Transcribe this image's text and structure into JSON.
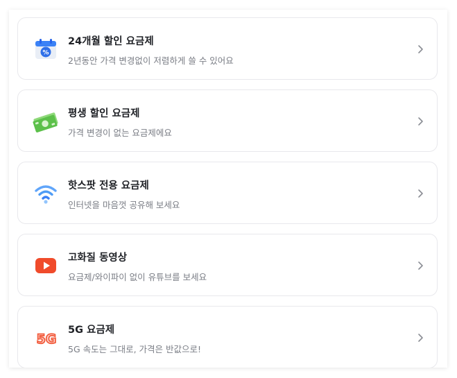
{
  "plans": [
    {
      "title": "24개월 할인 요금제",
      "description": "2년동안 가격 변경없이 저렴하게 쓸 수 있어요",
      "icon": "calendar-discount-icon"
    },
    {
      "title": "평생 할인 요금제",
      "description": "가격 변경이 없는 요금제에요",
      "icon": "money-icon"
    },
    {
      "title": "핫스팟 전용 요금제",
      "description": "인터넷을 마음껏 공유해 보세요",
      "icon": "wifi-icon"
    },
    {
      "title": "고화질 동영상",
      "description": "요금제/와이파이 없이 유튜브를 보세요",
      "icon": "play-icon"
    },
    {
      "title": "5G 요금제",
      "description": "5G 속도는 그대로, 가격은 반값으로!",
      "icon": "5g-icon",
      "icon_text": "5G"
    }
  ],
  "colors": {
    "accent_blue": "#3b82f6",
    "green": "#6fcf5a",
    "red": "#f25c3d",
    "youtube_red": "#f04b2b"
  }
}
